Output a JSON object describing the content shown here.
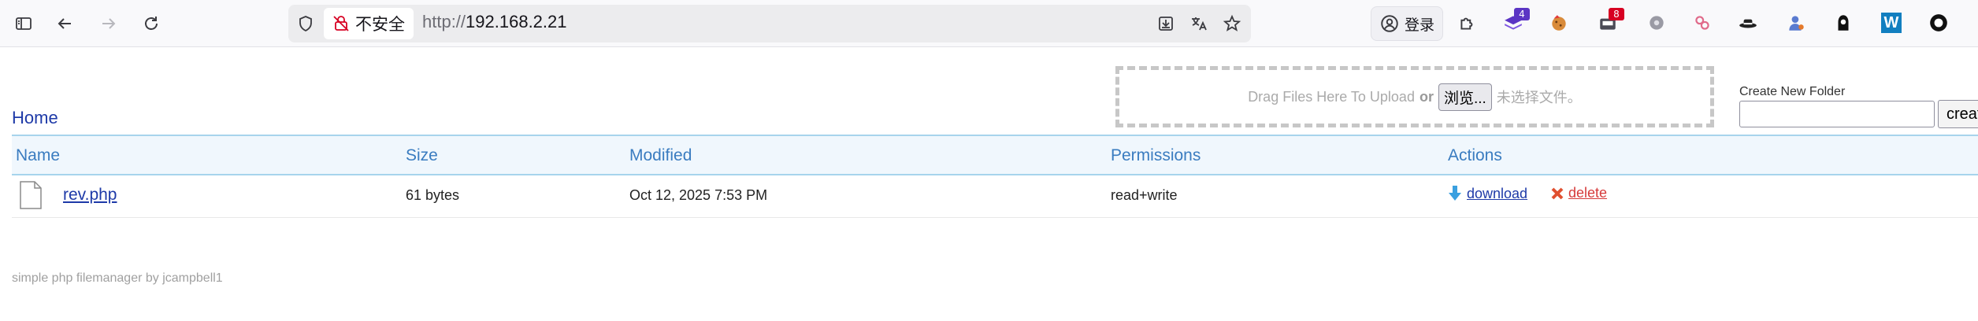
{
  "browser": {
    "security_label": "不安全",
    "url_protocol": "http://",
    "url_host": "192.168.2.21",
    "login_label": "登录",
    "extension_badges": {
      "ext1": "4",
      "ext3": "8"
    },
    "extension_icons": [
      "puzzle-icon",
      "layers-icon",
      "cookie-icon",
      "inbox-icon",
      "gear-icon",
      "flower-icon",
      "hat-icon",
      "user-icon",
      "hacker-icon",
      "w-icon",
      "circle-icon"
    ]
  },
  "breadcrumb": {
    "home": "Home"
  },
  "upload": {
    "drop_text": "Drag Files Here To Upload",
    "or_text": "or",
    "browse_label": "浏览...",
    "no_file_text": "未选择文件。"
  },
  "mkdir": {
    "label": "Create New Folder",
    "button_label": "creat",
    "input_value": ""
  },
  "table": {
    "columns": [
      "Name",
      "Size",
      "Modified",
      "Permissions",
      "Actions"
    ],
    "rows": [
      {
        "name": "rev.php",
        "size": "61 bytes",
        "modified": "Oct 12, 2025 7:53 PM",
        "permissions": "read+write",
        "download_label": "download",
        "delete_label": "delete"
      }
    ]
  },
  "footer": {
    "text": "simple php filemanager by jcampbell1"
  },
  "colors": {
    "link": "#1e3aa8",
    "header_bg": "#f0f7fd",
    "header_border": "#a7d4ec",
    "delete": "#d63a3a"
  }
}
